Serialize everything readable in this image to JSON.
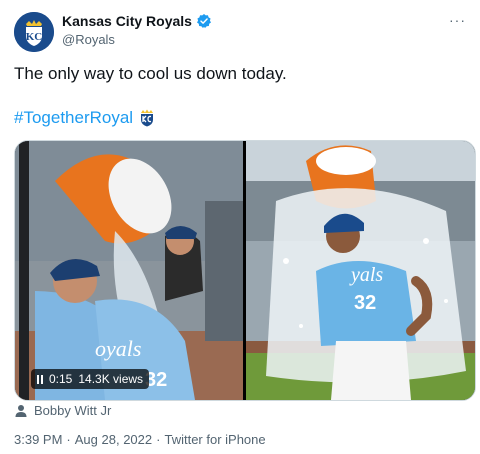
{
  "author": {
    "display_name": "Kansas City Royals",
    "handle": "@Royals",
    "avatar_icon": "kc-royals-logo-icon",
    "verified_icon": "verified-badge-icon"
  },
  "more_icon": "more-options-icon",
  "more_glyph": "···",
  "tweet": {
    "text": "The only way to cool us down today.",
    "hashtag": "#TogetherRoyal",
    "hashflag_icon": "kc-crown-shield-icon"
  },
  "media": {
    "video": {
      "time": "0:15",
      "views": "14.3K views"
    }
  },
  "tagged": {
    "name": "Bobby Witt Jr",
    "icon": "person-icon"
  },
  "meta": {
    "time": "3:39 PM",
    "date": "Aug 28, 2022",
    "separator": "·",
    "source": "Twitter for iPhone"
  },
  "colors": {
    "link": "#1d9bf0",
    "verified": "#1d9bf0",
    "secondary_text": "#536471",
    "royals_blue": "#1a4b8c",
    "powder_blue": "#5fa8dc",
    "cooler_orange": "#e8741e"
  }
}
